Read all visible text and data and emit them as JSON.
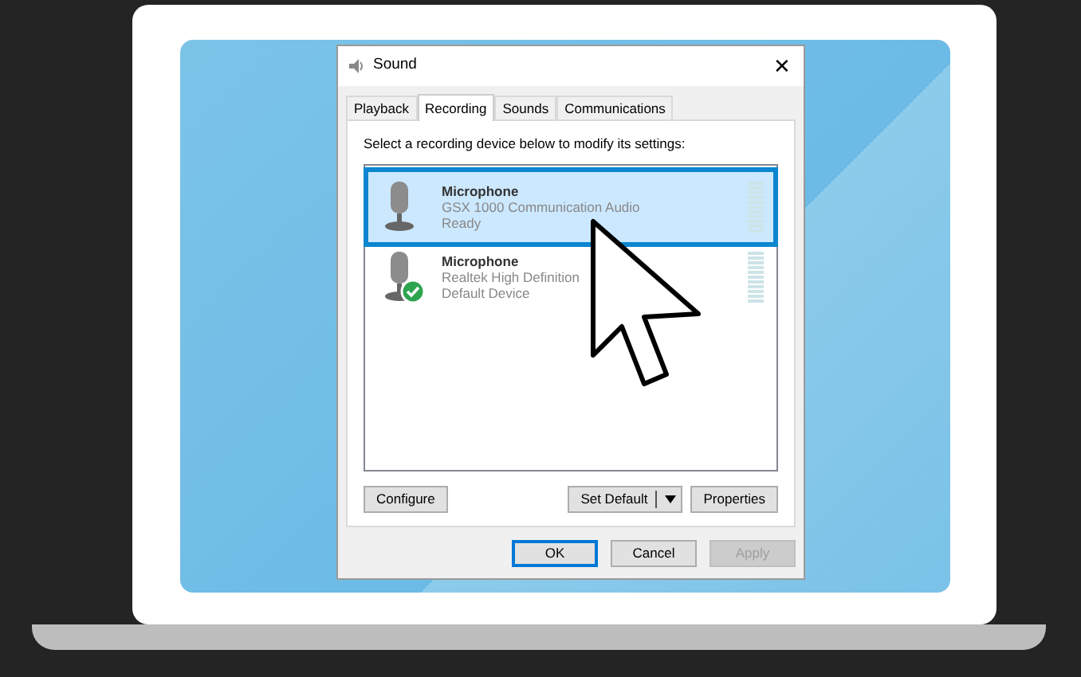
{
  "window": {
    "title": "Sound",
    "close_glyph": "✕"
  },
  "tabs": [
    {
      "label": "Playback",
      "selected": false
    },
    {
      "label": "Recording",
      "selected": true
    },
    {
      "label": "Sounds",
      "selected": false
    },
    {
      "label": "Communications",
      "selected": false
    }
  ],
  "instruction": "Select a recording device below to modify its settings:",
  "devices": [
    {
      "name": "Microphone",
      "description": "GSX 1000 Communication Audio",
      "status": "Ready",
      "selected": true,
      "is_default": false
    },
    {
      "name": "Microphone",
      "description": "Realtek High Definition",
      "status": "Default Device",
      "selected": false,
      "is_default": true
    }
  ],
  "device_buttons": [
    {
      "label": "Configure",
      "kind": "plain"
    },
    {
      "label": "Set Default",
      "kind": "split"
    },
    {
      "label": "Properties",
      "kind": "plain"
    }
  ],
  "dialog_buttons": [
    {
      "label": "OK",
      "disabled": false,
      "focused": true
    },
    {
      "label": "Cancel",
      "disabled": false,
      "focused": false
    },
    {
      "label": "Apply",
      "disabled": true,
      "focused": false
    }
  ]
}
